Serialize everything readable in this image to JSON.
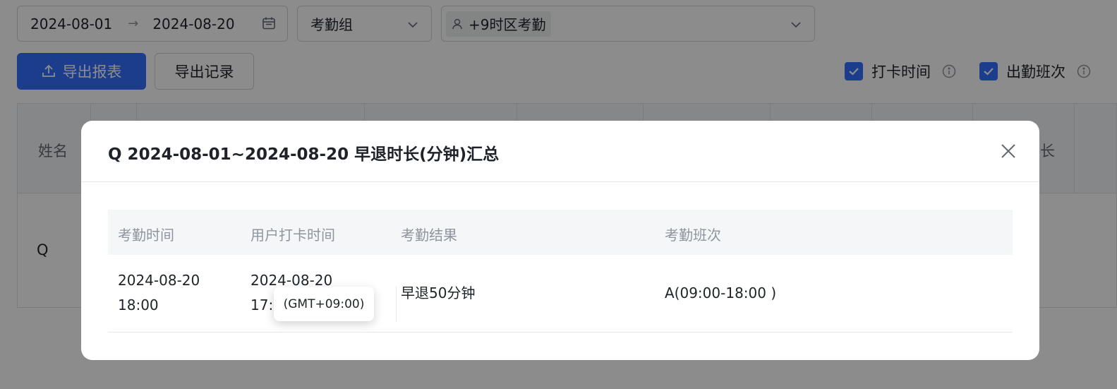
{
  "filters": {
    "date_start": "2024-08-01",
    "date_arrow": "→",
    "date_end": "2024-08-20",
    "group_placeholder": "考勤组",
    "tz_tag": "+9时区考勤"
  },
  "toolbar": {
    "export_report": "导出报表",
    "export_history": "导出记录",
    "checkbox_punch": "打卡时间",
    "checkbox_shift": "出勤班次"
  },
  "bg_table": {
    "header_name": "姓名",
    "header_tail": "长",
    "row_name": "Q"
  },
  "modal": {
    "title": "Q 2024-08-01~2024-08-20 早退时长(分钟)汇总",
    "columns": [
      "考勤时间",
      "用户打卡时间",
      "考勤结果",
      "考勤班次"
    ],
    "row": {
      "attendance_time_line1": "2024-08-20",
      "attendance_time_line2": "18:00",
      "punch_time_line1": "2024-08-20",
      "punch_time_line2": "17:1",
      "result": "早退50分钟",
      "shift": "A(09:00-18:00 )"
    },
    "tooltip": "(GMT+09:00)"
  },
  "colors": {
    "primary": "#3370ff",
    "mask": "rgba(0,0,0,0.45)"
  }
}
